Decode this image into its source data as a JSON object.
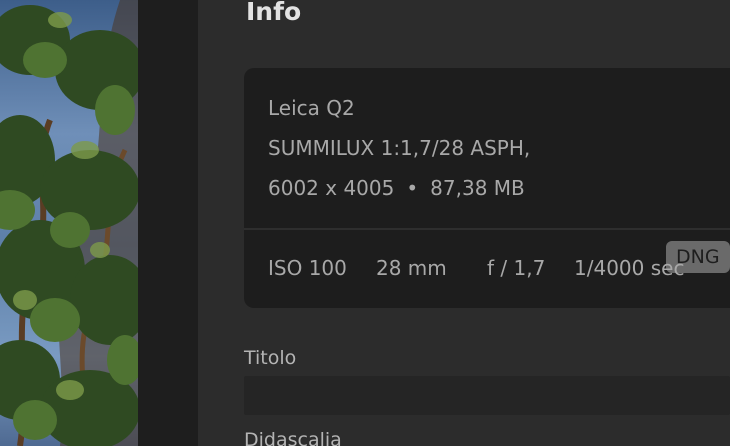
{
  "panel": {
    "title": "Info"
  },
  "camera": {
    "model": "Leica Q2",
    "lens": "SUMMILUX 1:1,7/28 ASPH,",
    "dimensions": "6002 x 4005",
    "separator": "•",
    "file_size": "87,38 MB",
    "format_badge": "DNG"
  },
  "exif": {
    "iso": "ISO 100",
    "focal_length": "28 mm",
    "aperture": "f / 1,7",
    "shutter": "1/4000 sec"
  },
  "fields": {
    "title_label": "Titolo",
    "title_value": "",
    "caption_label": "Didascalia"
  },
  "colors": {
    "panel_bg": "#2c2c2c",
    "card_bg": "#1d1d1d",
    "badge_bg": "#6a6a6a"
  }
}
